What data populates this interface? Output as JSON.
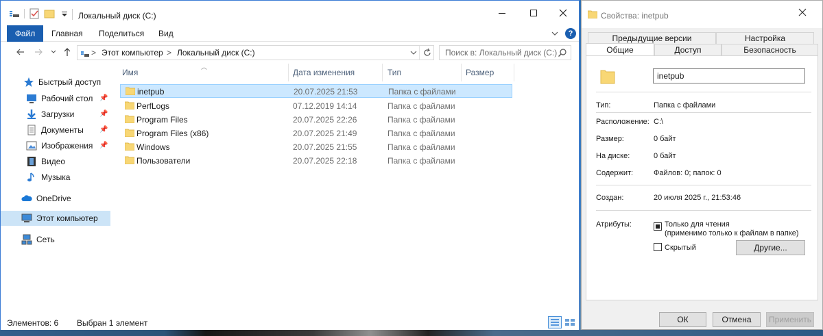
{
  "explorer": {
    "title": "Локальный диск (C:)",
    "ribbon_tabs": [
      "Файл",
      "Главная",
      "Поделиться",
      "Вид"
    ],
    "help_label": "?",
    "address": {
      "segments": [
        "Этот компьютер",
        "Локальный диск (C:)"
      ],
      "separator": ">"
    },
    "search_placeholder": "Поиск в: Локальный диск (C:)",
    "nav": [
      {
        "label": "Быстрый доступ",
        "icon": "star-icon",
        "pinned": false
      },
      {
        "label": "Рабочий стол",
        "icon": "desktop-icon",
        "pinned": true
      },
      {
        "label": "Загрузки",
        "icon": "download-icon",
        "pinned": true
      },
      {
        "label": "Документы",
        "icon": "documents-icon",
        "pinned": true
      },
      {
        "label": "Изображения",
        "icon": "pictures-icon",
        "pinned": true
      },
      {
        "label": "Видео",
        "icon": "video-icon",
        "pinned": false
      },
      {
        "label": "Музыка",
        "icon": "music-icon",
        "pinned": false
      },
      {
        "label": "OneDrive",
        "icon": "cloud-icon",
        "pinned": false
      },
      {
        "label": "Этот компьютер",
        "icon": "computer-icon",
        "pinned": false,
        "selected": true
      },
      {
        "label": "Сеть",
        "icon": "network-icon",
        "pinned": false
      }
    ],
    "columns": [
      "Имя",
      "Дата изменения",
      "Тип",
      "Размер"
    ],
    "files": [
      {
        "name": "inetpub",
        "date": "20.07.2025 21:53",
        "type": "Папка с файлами",
        "selected": true
      },
      {
        "name": "PerfLogs",
        "date": "07.12.2019 14:14",
        "type": "Папка с файлами"
      },
      {
        "name": "Program Files",
        "date": "20.07.2025 22:26",
        "type": "Папка с файлами"
      },
      {
        "name": "Program Files (x86)",
        "date": "20.07.2025 21:49",
        "type": "Папка с файлами"
      },
      {
        "name": "Windows",
        "date": "20.07.2025 21:55",
        "type": "Папка с файлами"
      },
      {
        "name": "Пользователи",
        "date": "20.07.2025 22:18",
        "type": "Папка с файлами"
      }
    ],
    "status": {
      "items_count": "Элементов: 6",
      "selected": "Выбран 1 элемент"
    }
  },
  "properties": {
    "title": "Свойства: inetpub",
    "tabs_row1": [
      "Предыдущие версии",
      "Настройка"
    ],
    "tabs_row2": [
      "Общие",
      "Доступ",
      "Безопасность"
    ],
    "active_tab": "Общие",
    "name_value": "inetpub",
    "type_label": "Тип:",
    "type_value": "Папка с файлами",
    "location_label": "Расположение:",
    "location_value": "C:\\",
    "size_label": "Размер:",
    "size_value": "0 байт",
    "disk_label": "На диске:",
    "disk_value": "0 байт",
    "contains_label": "Содержит:",
    "contains_value": "Файлов: 0; папок: 0",
    "created_label": "Создан:",
    "created_value": "20 июля 2025 г., 21:53:46",
    "attributes_label": "Атрибуты:",
    "readonly_label": "Только для чтения",
    "readonly_note": "(применимо только к файлам в папке)",
    "hidden_label": "Скрытый",
    "other_button": "Другие...",
    "ok_button": "ОК",
    "cancel_button": "Отмена",
    "apply_button": "Применить"
  },
  "colors": {
    "accent": "#1a5eb0",
    "selection": "#cce8ff",
    "folder": "#f8d775"
  }
}
